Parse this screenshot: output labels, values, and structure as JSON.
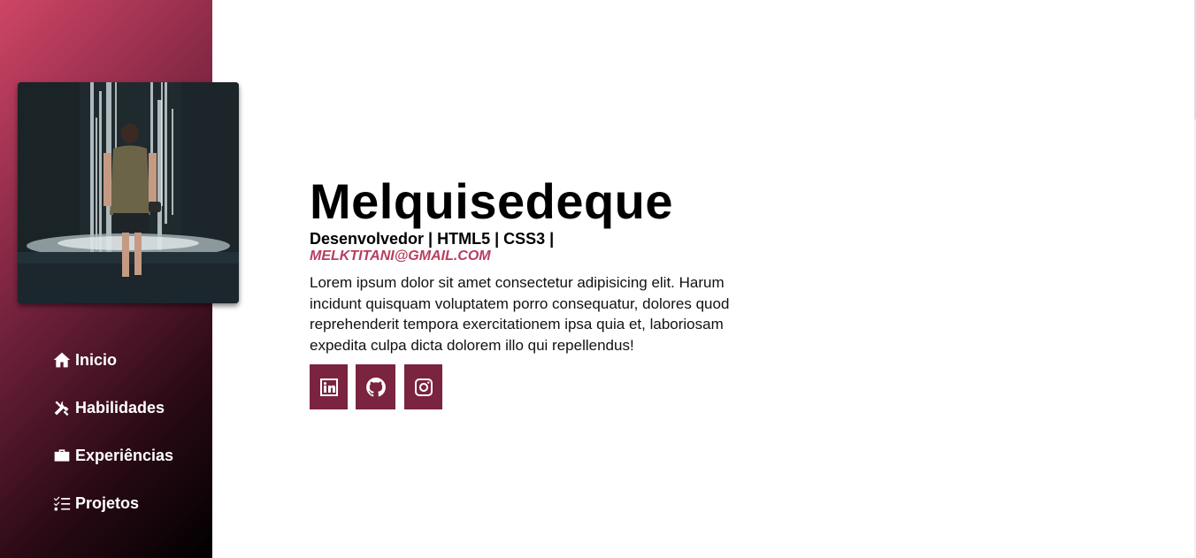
{
  "sidebar": {
    "photo_alt": "",
    "nav": [
      {
        "label": "Inicio",
        "icon": "home-icon"
      },
      {
        "label": "Habilidades",
        "icon": "tools-icon"
      },
      {
        "label": "Experiências",
        "icon": "briefcase-icon"
      },
      {
        "label": "Projetos",
        "icon": "tasks-icon"
      }
    ]
  },
  "profile": {
    "name": "Melquisedeque",
    "role": "Desenvolvedor | HTML5 | CSS3 |",
    "email": "MELKTITANI@GMAIL.COM",
    "bio": "Lorem ipsum dolor sit amet consectetur adipisicing elit. Harum incidunt quisquam voluptatem porro consequatur, dolores quod reprehenderit tempora exercitationem ipsa quia et, laboriosam expedita culpa dicta dolorem illo qui repellendus!"
  },
  "socials": [
    {
      "icon": "linkedin-icon"
    },
    {
      "icon": "github-icon"
    },
    {
      "icon": "instagram-icon"
    }
  ],
  "colors": {
    "accent": "#7a2440",
    "email": "#b83d5f",
    "sidebar_top": "#cf4566",
    "sidebar_bottom": "#000000"
  }
}
